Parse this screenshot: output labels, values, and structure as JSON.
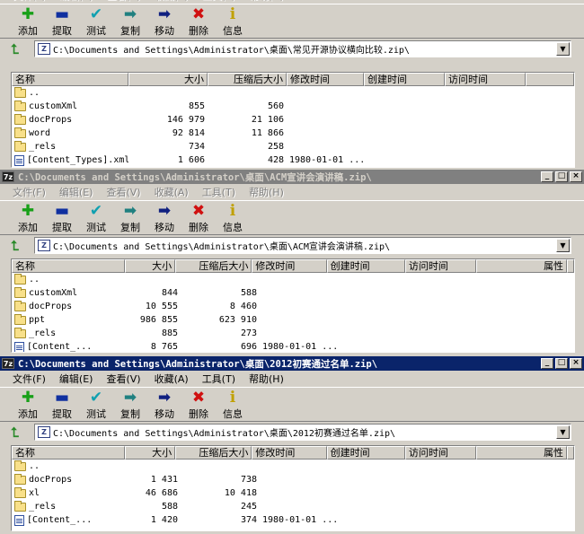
{
  "menu": [
    "文件(F)",
    "编辑(E)",
    "查看(V)",
    "收藏(A)",
    "工具(T)",
    "帮助(H)"
  ],
  "tools": [
    {
      "label": "添加",
      "icon": "plus-icon",
      "glyph": "✚",
      "color": "#18a018"
    },
    {
      "label": "提取",
      "icon": "minus-icon",
      "glyph": "▬",
      "color": "#1030a0"
    },
    {
      "label": "测试",
      "icon": "check-icon",
      "glyph": "✔",
      "color": "#10a0b0"
    },
    {
      "label": "复制",
      "icon": "copy-arrow-icon",
      "glyph": "➡",
      "color": "#208080"
    },
    {
      "label": "移动",
      "icon": "move-arrow-icon",
      "glyph": "➡",
      "color": "#102080"
    },
    {
      "label": "删除",
      "icon": "delete-x-icon",
      "glyph": "✖",
      "color": "#d01010"
    },
    {
      "label": "信息",
      "icon": "info-icon",
      "glyph": "ℹ",
      "color": "#c0a000"
    }
  ],
  "windows": [
    {
      "title": "",
      "address": "C:\\Documents and Settings\\Administrator\\桌面\\常见开源协议横向比较.zip\\",
      "headers": [
        "名称",
        "大小",
        "压缩后大小",
        "修改时间",
        "创建时间",
        "访问时间"
      ],
      "rows": [
        {
          "icon": "folder",
          "name": "..",
          "size": "",
          "packed": "",
          "modified": ""
        },
        {
          "icon": "folder",
          "name": "customXml",
          "size": "855",
          "packed": "560",
          "modified": ""
        },
        {
          "icon": "folder",
          "name": "docProps",
          "size": "146 979",
          "packed": "21 106",
          "modified": ""
        },
        {
          "icon": "folder",
          "name": "word",
          "size": "92 814",
          "packed": "11 866",
          "modified": ""
        },
        {
          "icon": "folder",
          "name": "_rels",
          "size": "734",
          "packed": "258",
          "modified": ""
        },
        {
          "icon": "file",
          "name": "[Content_Types].xml",
          "size": "1 606",
          "packed": "428",
          "modified": "1980-01-01 ..."
        }
      ]
    },
    {
      "title": "C:\\Documents and Settings\\Administrator\\桌面\\ACM宣讲会演讲稿.zip\\",
      "address": "C:\\Documents and Settings\\Administrator\\桌面\\ACM宣讲会演讲稿.zip\\",
      "headers": [
        "名称",
        "大小",
        "压缩后大小",
        "修改时间",
        "创建时间",
        "访问时间",
        "属性"
      ],
      "rows": [
        {
          "icon": "folder",
          "name": "..",
          "size": "",
          "packed": "",
          "modified": ""
        },
        {
          "icon": "folder",
          "name": "customXml",
          "size": "844",
          "packed": "588",
          "modified": ""
        },
        {
          "icon": "folder",
          "name": "docProps",
          "size": "10 555",
          "packed": "8 460",
          "modified": ""
        },
        {
          "icon": "folder",
          "name": "ppt",
          "size": "986 855",
          "packed": "623 910",
          "modified": ""
        },
        {
          "icon": "folder",
          "name": "_rels",
          "size": "885",
          "packed": "273",
          "modified": ""
        },
        {
          "icon": "file",
          "name": "[Content_...",
          "size": "8 765",
          "packed": "696",
          "modified": "1980-01-01 ..."
        }
      ]
    },
    {
      "title": "C:\\Documents and Settings\\Administrator\\桌面\\2012初赛通过名单.zip\\",
      "address": "C:\\Documents and Settings\\Administrator\\桌面\\2012初赛通过名单.zip\\",
      "headers": [
        "名称",
        "大小",
        "压缩后大小",
        "修改时间",
        "创建时间",
        "访问时间",
        "属性"
      ],
      "rows": [
        {
          "icon": "folder",
          "name": "..",
          "size": "",
          "packed": "",
          "modified": ""
        },
        {
          "icon": "folder",
          "name": "docProps",
          "size": "1 431",
          "packed": "738",
          "modified": ""
        },
        {
          "icon": "folder",
          "name": "xl",
          "size": "46 686",
          "packed": "10 418",
          "modified": ""
        },
        {
          "icon": "folder",
          "name": "_rels",
          "size": "588",
          "packed": "245",
          "modified": ""
        },
        {
          "icon": "file",
          "name": "[Content_...",
          "size": "1 420",
          "packed": "374",
          "modified": "1980-01-01 ..."
        }
      ]
    }
  ]
}
